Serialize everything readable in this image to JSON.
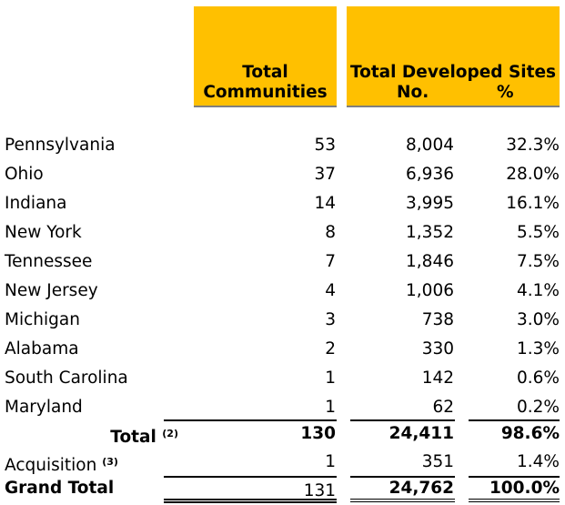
{
  "header": {
    "communities": [
      "Total",
      "Communities"
    ],
    "sites_title": "Total Developed Sites",
    "no_label": "No.",
    "pct_label": "%",
    "color": "#FFC000"
  },
  "rows": [
    {
      "state": "Pennsylvania",
      "communities": "53",
      "sites": "8,004",
      "pct": "32.3%"
    },
    {
      "state": "Ohio",
      "communities": "37",
      "sites": "6,936",
      "pct": "28.0%"
    },
    {
      "state": "Indiana",
      "communities": "14",
      "sites": "3,995",
      "pct": "16.1%"
    },
    {
      "state": "New York",
      "communities": "8",
      "sites": "1,352",
      "pct": "5.5%"
    },
    {
      "state": "Tennessee",
      "communities": "7",
      "sites": "1,846",
      "pct": "7.5%"
    },
    {
      "state": "New Jersey",
      "communities": "4",
      "sites": "1,006",
      "pct": "4.1%"
    },
    {
      "state": "Michigan",
      "communities": "3",
      "sites": "738",
      "pct": "3.0%"
    },
    {
      "state": "Alabama",
      "communities": "2",
      "sites": "330",
      "pct": "1.3%"
    },
    {
      "state": "South Carolina",
      "communities": "1",
      "sites": "142",
      "pct": "0.6%"
    },
    {
      "state": "Maryland",
      "communities": "1",
      "sites": "62",
      "pct": "0.2%"
    }
  ],
  "total": {
    "label": "Total",
    "note": "(2)",
    "communities": "130",
    "sites": "24,411",
    "pct": "98.6%"
  },
  "acquisition": {
    "label": "Acquisition",
    "note": "(3)",
    "communities": "1",
    "sites": "351",
    "pct": "1.4%"
  },
  "grand_total": {
    "label": "Grand Total",
    "communities": "131",
    "sites": "24,762",
    "pct": "100.0%"
  }
}
